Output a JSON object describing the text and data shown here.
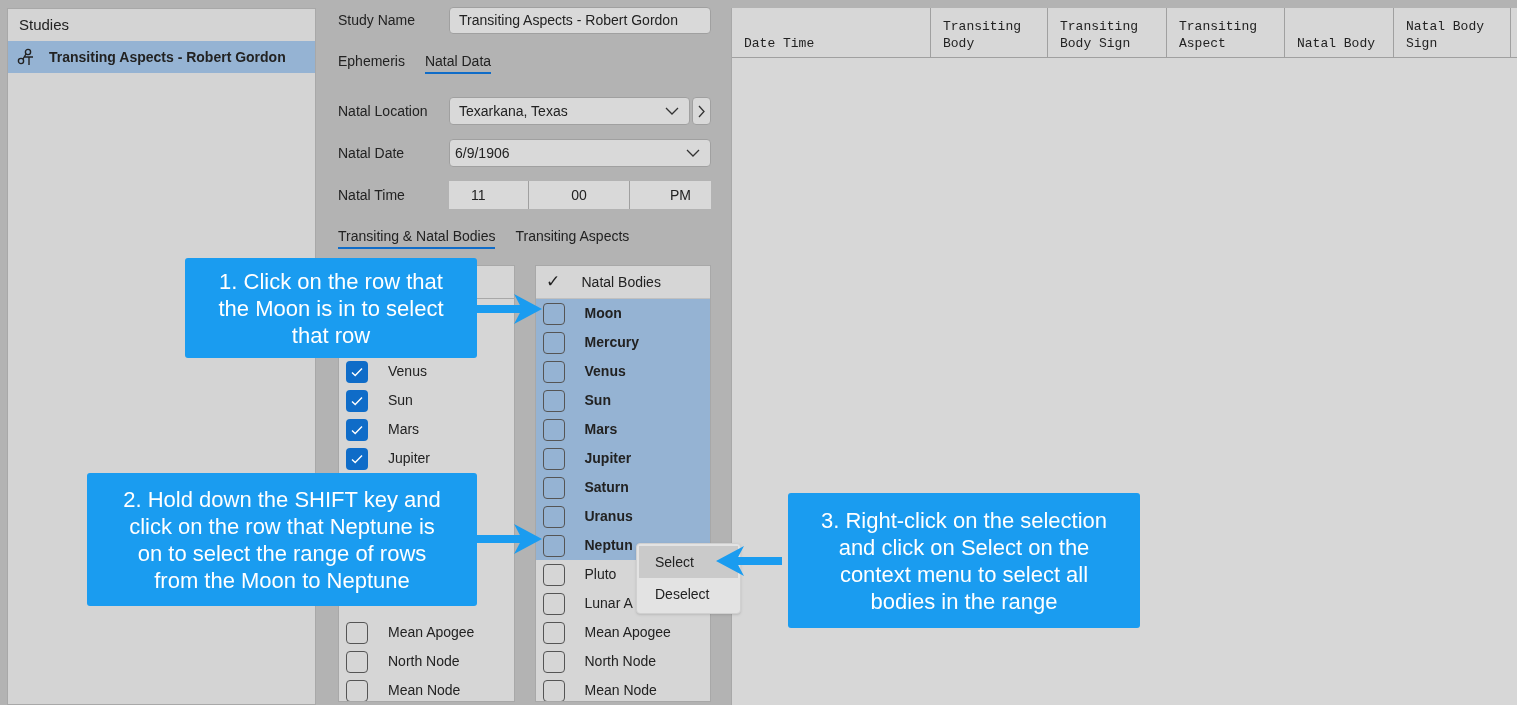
{
  "studies": {
    "title": "Studies",
    "items": [
      {
        "label": "Transiting Aspects - Robert Gordon",
        "selected": true
      }
    ]
  },
  "study_name": {
    "label": "Study Name",
    "value": "Transiting Aspects - Robert Gordon"
  },
  "tabs": [
    {
      "label": "Ephemeris",
      "selected": false
    },
    {
      "label": "Natal Data",
      "selected": true
    }
  ],
  "natal_location": {
    "label": "Natal Location",
    "value": "Texarkana, Texas"
  },
  "natal_date": {
    "label": "Natal Date",
    "value": "6/9/1906"
  },
  "natal_time": {
    "label": "Natal Time",
    "hour": "11",
    "minute": "00",
    "ampm": "PM"
  },
  "sub_tabs": [
    {
      "label": "Transiting & Natal Bodies",
      "selected": true
    },
    {
      "label": "Transiting Aspects",
      "selected": false
    }
  ],
  "transiting_bodies": {
    "upper": [
      {
        "label": "Venus",
        "checked": true
      },
      {
        "label": "Sun",
        "checked": true
      },
      {
        "label": "Mars",
        "checked": true
      },
      {
        "label": "Jupiter",
        "checked": true
      }
    ],
    "lower": [
      {
        "label": "Mean Apogee",
        "checked": false
      },
      {
        "label": "North Node",
        "checked": false
      },
      {
        "label": "Mean Node",
        "checked": false
      }
    ]
  },
  "natal_bodies": {
    "header_mark": "✓",
    "header": "Natal Bodies",
    "rows": [
      {
        "label": "Moon",
        "checked": false,
        "selected": true
      },
      {
        "label": "Mercury",
        "checked": false,
        "selected": true
      },
      {
        "label": "Venus",
        "checked": false,
        "selected": true
      },
      {
        "label": "Sun",
        "checked": false,
        "selected": true
      },
      {
        "label": "Mars",
        "checked": false,
        "selected": true
      },
      {
        "label": "Jupiter",
        "checked": false,
        "selected": true
      },
      {
        "label": "Saturn",
        "checked": false,
        "selected": true
      },
      {
        "label": "Uranus",
        "checked": false,
        "selected": true
      },
      {
        "label": "Neptun",
        "checked": false,
        "selected": true
      },
      {
        "label": "Pluto",
        "checked": false,
        "selected": false
      },
      {
        "label": "Lunar A",
        "checked": false,
        "selected": false
      },
      {
        "label": "Mean Apogee",
        "checked": false,
        "selected": false
      },
      {
        "label": "North Node",
        "checked": false,
        "selected": false
      },
      {
        "label": "Mean Node",
        "checked": false,
        "selected": false
      }
    ]
  },
  "context_menu": [
    {
      "label": "Select",
      "selected": true
    },
    {
      "label": "Deselect",
      "selected": false
    }
  ],
  "table": {
    "columns": [
      "Date Time",
      "Transiting Body",
      "Transiting Body Sign",
      "Transiting Aspect",
      "Natal Body",
      "Natal Body Sign"
    ]
  },
  "callouts": [
    "1. Click on the row that the Moon is in to select that row",
    "2. Hold down the SHIFT key and click on the row that Neptune is on to select the range of rows from the Moon to Neptune",
    "3. Right-click on the selection and click on Select on the context menu to select all bodies in the range"
  ]
}
